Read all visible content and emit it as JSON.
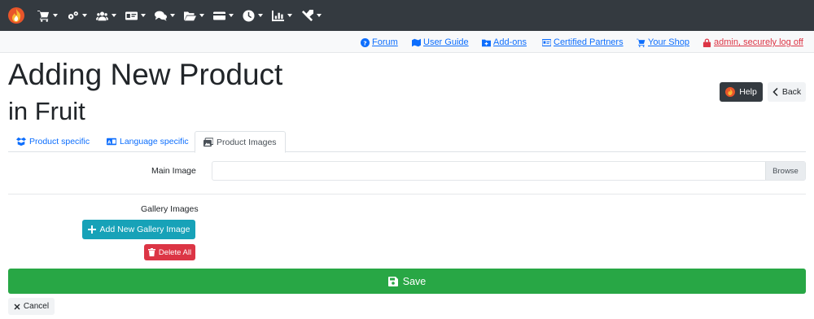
{
  "header": {
    "logo_icon": "flame-logo-icon",
    "menu": [
      {
        "icon": "shopping-cart-icon"
      },
      {
        "icon": "gears-icon"
      },
      {
        "icon": "users-icon"
      },
      {
        "icon": "id-card-icon"
      },
      {
        "icon": "comments-icon"
      },
      {
        "icon": "folder-open-icon"
      },
      {
        "icon": "credit-card-icon"
      },
      {
        "icon": "clock-icon"
      },
      {
        "icon": "chart-bar-icon"
      },
      {
        "icon": "tools-icon"
      }
    ]
  },
  "toplinks": {
    "forum": "Forum",
    "user_guide": "User Guide",
    "addons": "Add-ons",
    "certified_partners": "Certified Partners",
    "your_shop": "Your Shop",
    "logoff": "admin, securely log off"
  },
  "page": {
    "title": "Adding New Product",
    "subtitle": "in Fruit",
    "help_label": "Help",
    "back_label": "Back"
  },
  "tabs": [
    {
      "label": "Product specific",
      "icon": "box-open-icon"
    },
    {
      "label": "Language specific",
      "icon": "language-icon"
    },
    {
      "label": "Product Images",
      "icon": "images-icon",
      "active": true
    }
  ],
  "form": {
    "main_image_label": "Main Image",
    "main_image_value": "",
    "browse_label": "Browse",
    "gallery_label": "Gallery Images",
    "add_gallery_label": "Add New Gallery Image",
    "delete_all_label": "Delete All"
  },
  "actions": {
    "save_label": "Save",
    "cancel_label": "Cancel"
  },
  "colors": {
    "topbar": "#343a40",
    "link": "#0d6efd",
    "danger": "#dc3545",
    "info": "#17a2b8",
    "success": "#28a745"
  }
}
